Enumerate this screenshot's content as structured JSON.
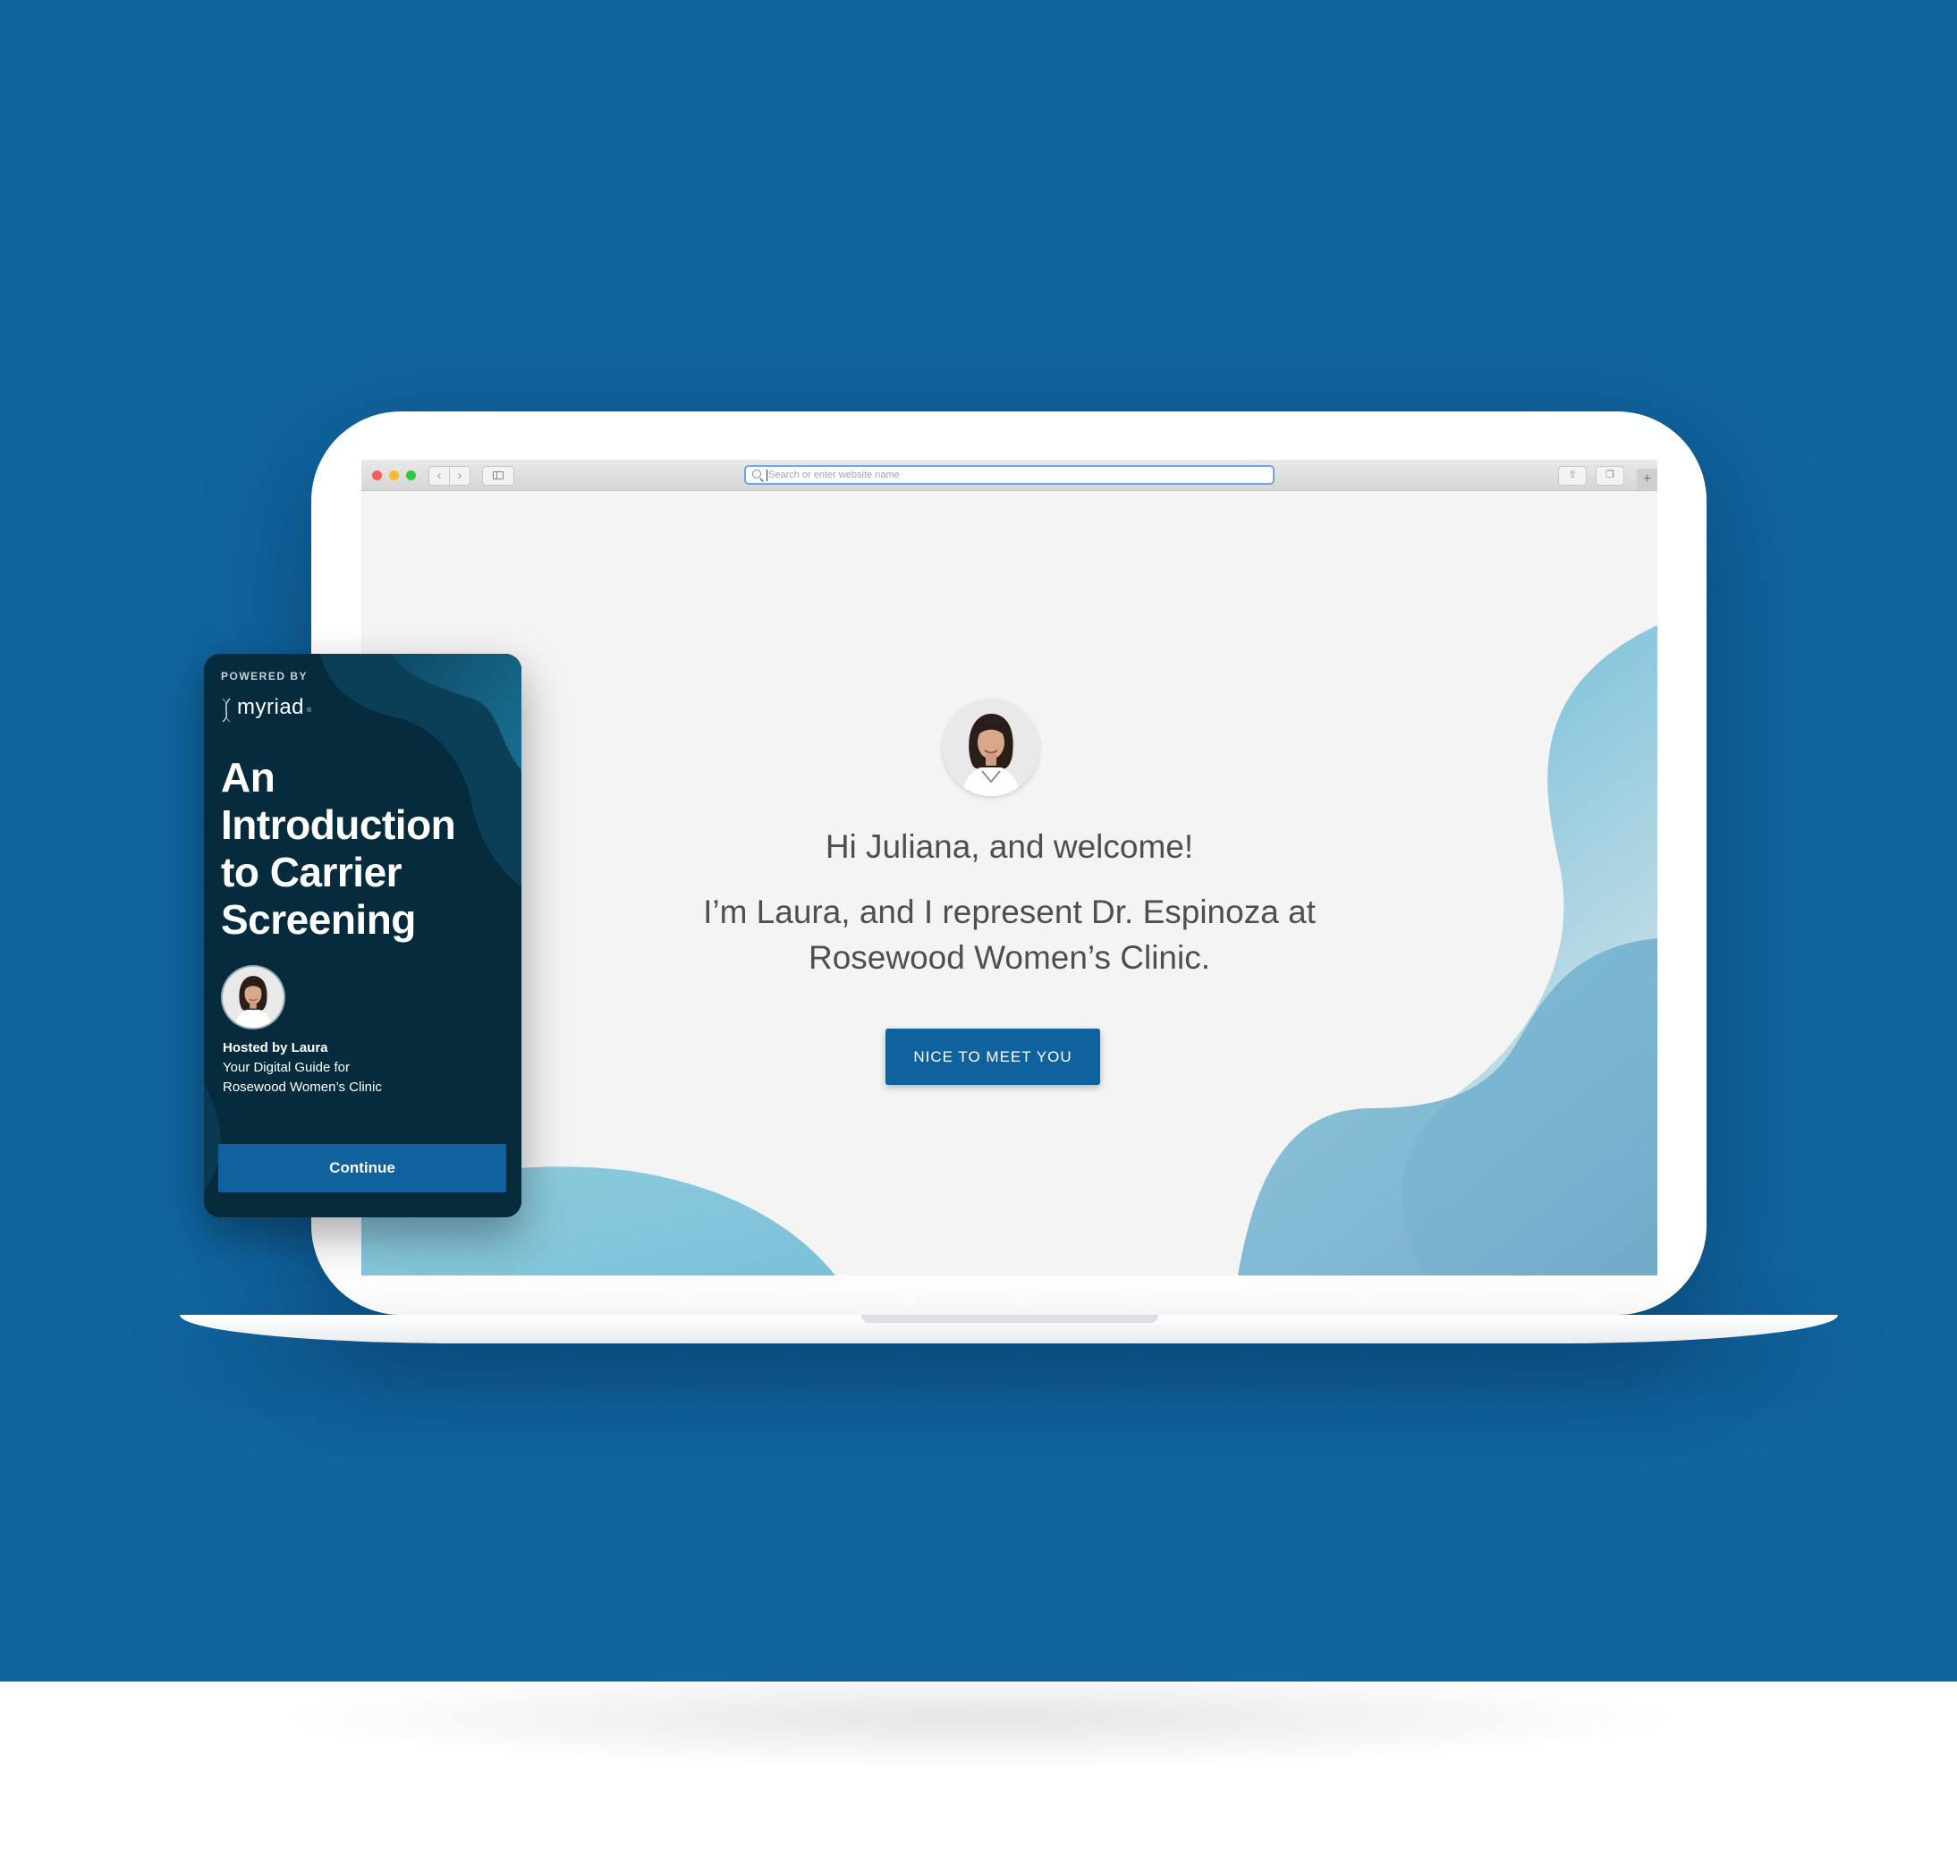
{
  "browser": {
    "address_placeholder": "Search or enter website name",
    "nav_back_glyph": "‹",
    "nav_forward_glyph": "›",
    "share_glyph": "⇧",
    "tabs_glyph": "❐",
    "new_tab_glyph": "+"
  },
  "welcome": {
    "greeting": "Hi Juliana, and welcome!",
    "intro_line1": "I’m Laura, and I represent Dr. Espinoza at",
    "intro_line2": "Rosewood Women’s Clinic.",
    "button_label": "NICE TO MEET YOU"
  },
  "card": {
    "powered_by": "POWERED BY",
    "brand": "myriad",
    "brand_reg": "®",
    "title_lines": [
      "An",
      "Introduction",
      "to Carrier",
      "Screening"
    ],
    "host_name": "Hosted by Laura",
    "host_role_line1": "Your Digital Guide for",
    "host_role_line2": "Rosewood Women’s Clinic",
    "continue_label": "Continue"
  },
  "colors": {
    "background": "#10649e",
    "button": "#10629f",
    "card_bg": "#062b3d",
    "accent_light": "#6fbad8"
  }
}
